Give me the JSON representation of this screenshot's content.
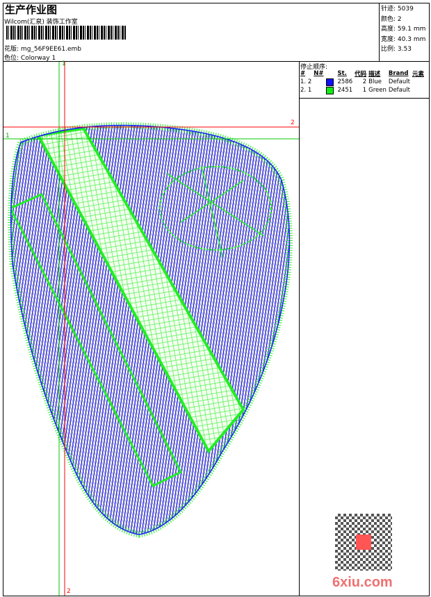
{
  "header": {
    "title": "生产作业图",
    "company": "Wilcom(汇泉) 装饰工作室",
    "design_label": "花版:",
    "design_file": "mg_56F9EE61.emb",
    "colorway_label": "色位:",
    "colorway": "Colorway 1"
  },
  "info": [
    {
      "label": "针迹:",
      "value": "5039"
    },
    {
      "label": "颜色:",
      "value": "2"
    },
    {
      "label": "高度:",
      "value": "59.1 mm"
    },
    {
      "label": "宽度:",
      "value": "40.3 mm"
    },
    {
      "label": "比例:",
      "value": "3.53"
    }
  ],
  "stop_sequence": {
    "title": "停止顺序:",
    "columns": [
      "#",
      "N#",
      "",
      "St.",
      "代码",
      "描述",
      "Brand",
      "元素"
    ],
    "rows": [
      {
        "index": "1.",
        "n": "2",
        "color": "#1010ff",
        "stitches": "2586",
        "code": "2",
        "desc": "Blue",
        "brand": "Default"
      },
      {
        "index": "2.",
        "n": "1",
        "color": "#10ee10",
        "stitches": "2451",
        "code": "1",
        "desc": "Green",
        "brand": "Default"
      }
    ]
  },
  "guides": {
    "v1": "1",
    "v2": "2",
    "h1": "1",
    "h2": "2"
  },
  "colors": {
    "blue": "#1a1aff",
    "green": "#22ee22",
    "red": "#ff0000"
  },
  "watermark": "6xiu.com"
}
